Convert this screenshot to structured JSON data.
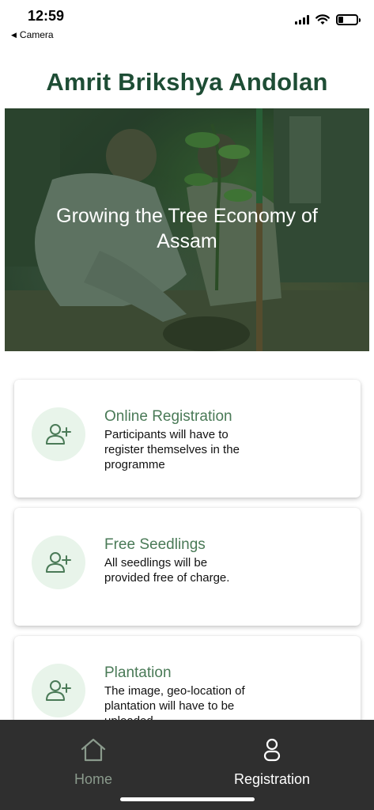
{
  "status_bar": {
    "time": "12:59",
    "back_app": "Camera",
    "battery_level": 0.25
  },
  "app": {
    "title": "Amrit Brikshya Andolan"
  },
  "hero": {
    "text": "Growing the Tree Economy of Assam"
  },
  "cards": [
    {
      "title": "Online Registration",
      "description": "Participants will have to register themselves in the programme",
      "icon": "add-user-icon"
    },
    {
      "title": "Free Seedlings",
      "description": "All seedlings will be provided free of charge.",
      "icon": "add-user-icon"
    },
    {
      "title": "Plantation",
      "description": "The image, geo-location of plantation will have to be uploaded",
      "icon": "add-user-icon"
    }
  ],
  "bottom_nav": {
    "items": [
      {
        "label": "Home",
        "icon": "home-icon",
        "active": false
      },
      {
        "label": "Registration",
        "icon": "user-icon",
        "active": true
      }
    ]
  },
  "colors": {
    "title": "#1e4d35",
    "accent": "#4a7a57",
    "icon_bg": "#e8f4ea",
    "nav_bg": "#2f2f2f"
  }
}
